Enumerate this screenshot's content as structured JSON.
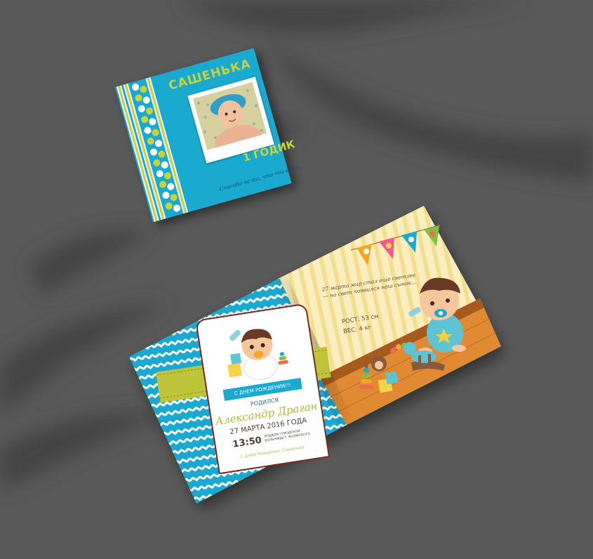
{
  "cover": {
    "title": "САШЕНЬКА",
    "age": "1 ГОДИК",
    "subtitle": "Спасибо за то, что ты есть..."
  },
  "invite": {
    "banner": "С ДНЕМ РОЖДЕНИЯ!!!",
    "born": "РОДИЛСЯ",
    "name": "Александр Драган",
    "date": "27 МАРТА 2016 ГОДА",
    "time": "13:50",
    "place": "РОДДОМ ГОРОДСКОЙ БОЛЬНИЦЫ Г. ВОЛЖСКОГО",
    "wish": "С Днём Рождения, Сашенька"
  },
  "right_page": {
    "poem": "27 марта мир стал еще светлее — на свет появился наш сынок...",
    "height": "РОСТ: 53 см",
    "weight": "ВЕС: 4 кг"
  },
  "colors": {
    "background": "#595959",
    "turquoise": "#1aa9cf",
    "lime": "#bfc53a",
    "cream": "#f8e7a8",
    "floor": "#e08a33"
  }
}
